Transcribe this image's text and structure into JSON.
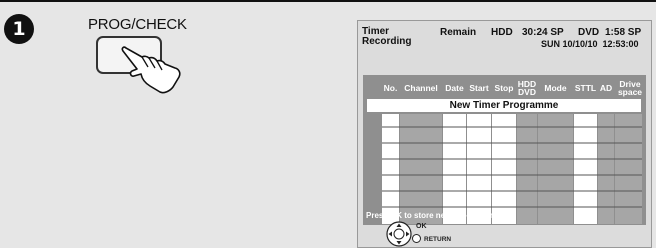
{
  "step": {
    "number": "1"
  },
  "remote": {
    "button_label": "PROG/CHECK"
  },
  "screen": {
    "title_line1": "Timer",
    "title_line2": "Recording",
    "remain_label": "Remain",
    "hdd_label": "HDD",
    "hdd_remain": "30:24 SP",
    "dvd_label": "DVD",
    "dvd_remain": "1:58 SP",
    "datetime": "SUN 10/10/10  12:53:00",
    "columns": {
      "no": "No.",
      "channel": "Channel",
      "date": "Date",
      "start": "Start",
      "stop": "Stop",
      "hdd_dvd_line1": "HDD",
      "hdd_dvd_line2": "DVD",
      "mode": "Mode",
      "sttl": "STTL",
      "ad": "AD",
      "drive_space_line1": "Drive",
      "drive_space_line2": "space"
    },
    "new_programme": "New Timer Programme",
    "status_text": "Press OK to store new programme.",
    "ok_label": "OK",
    "return_label": "RETURN"
  }
}
